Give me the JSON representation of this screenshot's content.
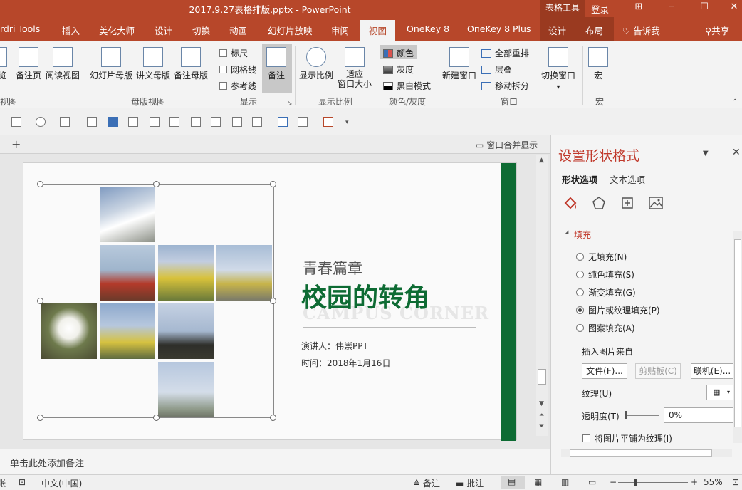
{
  "window": {
    "title": "2017.9.27表格排版.pptx  -  PowerPoint",
    "context_tab_group": "表格工具",
    "login": "登录"
  },
  "tabs": {
    "items": [
      "rdri Tools",
      "插入",
      "美化大师",
      "设计",
      "切换",
      "动画",
      "幻灯片放映",
      "审阅",
      "视图",
      "OneKey 8",
      "OneKey 8 Plus",
      "设计",
      "布局"
    ],
    "active": "视图",
    "tell_me": "告诉我",
    "share": "共享"
  },
  "ribbon": {
    "views": {
      "b1": "览",
      "b2": "备注页",
      "b3": "阅读视图",
      "label": "视图"
    },
    "master": {
      "b1": "幻灯片母版",
      "b2": "讲义母版",
      "b3": "备注母版",
      "label": "母版视图"
    },
    "show": {
      "ruler": "标尺",
      "gridlines": "网格线",
      "guides": "参考线",
      "notes": "备注",
      "label": "显示"
    },
    "zoom": {
      "b1": "显示比例",
      "b2_line1": "适应",
      "b2_line2": "窗口大小",
      "label": "显示比例"
    },
    "color": {
      "color": "颜色",
      "gray": "灰度",
      "bw": "黑白模式",
      "label": "颜色/灰度"
    },
    "window": {
      "new": "新建窗口",
      "arrange": "全部重排",
      "cascade": "层叠",
      "move": "移动拆分",
      "label": "窗口"
    },
    "switch": {
      "b1": "切换窗口"
    },
    "macro": {
      "b1": "宏",
      "label": "宏"
    }
  },
  "workspace": {
    "merge_display": "窗口合并显示",
    "notes_placeholder": "单击此处添加备注"
  },
  "slide": {
    "subtitle": "青春篇章",
    "title": "校园的转角",
    "english_title": "CAMPUS CORNER",
    "speaker": "演讲人：伟崇PPT",
    "time": "时间：2018年1月16日",
    "accent_color": "#0d6b33"
  },
  "pane": {
    "title": "设置形状格式",
    "tab_shape": "形状选项",
    "tab_text": "文本选项",
    "icons": [
      "fill-line-icon",
      "effects-icon",
      "size-properties-icon",
      "picture-icon"
    ],
    "fill_header": "填充",
    "fill_options": [
      {
        "label": "无填充(N)",
        "selected": false
      },
      {
        "label": "纯色填充(S)",
        "selected": false
      },
      {
        "label": "渐变填充(G)",
        "selected": false
      },
      {
        "label": "图片或纹理填充(P)",
        "selected": true
      },
      {
        "label": "图案填充(A)",
        "selected": false
      }
    ],
    "insert_from": "插入图片来自",
    "btn_file": "文件(F)...",
    "btn_clipboard": "剪贴板(C)",
    "btn_online": "联机(E)...",
    "texture": "纹理(U)",
    "transparency": "透明度(T)",
    "transparency_value": "0%",
    "tile": "将图片平铺为纹理(I)"
  },
  "status": {
    "lang_left": "张",
    "language": "中文(中国)",
    "notes": "备注",
    "comments": "批注",
    "zoom": "55%"
  }
}
